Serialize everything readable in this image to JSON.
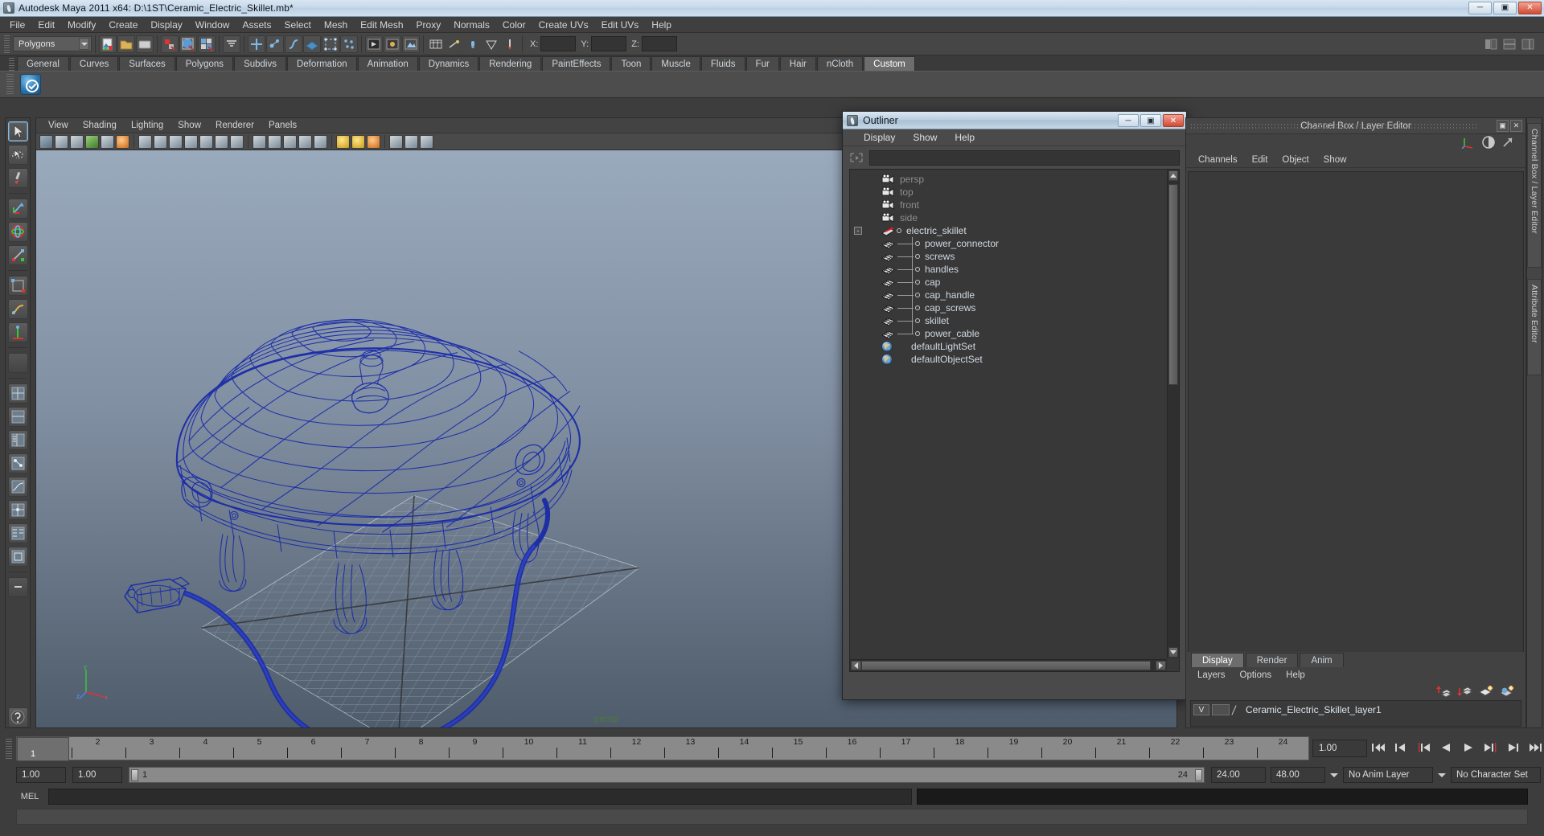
{
  "window": {
    "title": "Autodesk Maya 2011 x64: D:\\1ST\\Ceramic_Electric_Skillet.mb*",
    "minimize": "─",
    "maximize": "▣",
    "close": "✕"
  },
  "menubar": {
    "items": [
      "File",
      "Edit",
      "Modify",
      "Create",
      "Display",
      "Window",
      "Assets",
      "Select",
      "Mesh",
      "Edit Mesh",
      "Proxy",
      "Normals",
      "Color",
      "Create UVs",
      "Edit UVs",
      "Help"
    ]
  },
  "statusline": {
    "mode_selector": "Polygons",
    "axis_labels": [
      "X:",
      "Y:",
      "Z:"
    ],
    "axis_values": [
      "",
      "",
      ""
    ]
  },
  "shelf": {
    "tabs": [
      "General",
      "Curves",
      "Surfaces",
      "Polygons",
      "Subdivs",
      "Deformation",
      "Animation",
      "Dynamics",
      "Rendering",
      "PaintEffects",
      "Toon",
      "Muscle",
      "Fluids",
      "Fur",
      "Hair",
      "nCloth",
      "Custom"
    ],
    "active_tab": "Custom"
  },
  "viewport_panel": {
    "menus": [
      "View",
      "Shading",
      "Lighting",
      "Show",
      "Renderer",
      "Panels"
    ],
    "camera_label": "persp",
    "axis_letters": {
      "y": "y",
      "z": "z",
      "x": "x"
    }
  },
  "outliner": {
    "title": "Outliner",
    "menus": [
      "Display",
      "Show",
      "Help"
    ],
    "search_value": "",
    "minimize": "─",
    "maximize": "▣",
    "close": "✕",
    "items": [
      {
        "label": "persp",
        "icon": "camera-icon",
        "kind": "camera",
        "dim": true,
        "indent": 0
      },
      {
        "label": "top",
        "icon": "camera-icon",
        "kind": "camera",
        "dim": true,
        "indent": 0
      },
      {
        "label": "front",
        "icon": "camera-icon",
        "kind": "camera",
        "dim": true,
        "indent": 0
      },
      {
        "label": "side",
        "icon": "camera-icon",
        "kind": "camera",
        "dim": true,
        "indent": 0
      },
      {
        "label": "electric_skillet",
        "icon": "transform-icon",
        "kind": "group",
        "dim": false,
        "indent": 0,
        "expander": "-"
      },
      {
        "label": "power_connector",
        "icon": "mesh-icon",
        "kind": "mesh",
        "dim": false,
        "indent": 1
      },
      {
        "label": "screws",
        "icon": "mesh-icon",
        "kind": "mesh",
        "dim": false,
        "indent": 1
      },
      {
        "label": "handles",
        "icon": "mesh-icon",
        "kind": "mesh",
        "dim": false,
        "indent": 1
      },
      {
        "label": "cap",
        "icon": "mesh-icon",
        "kind": "mesh",
        "dim": false,
        "indent": 1
      },
      {
        "label": "cap_handle",
        "icon": "mesh-icon",
        "kind": "mesh",
        "dim": false,
        "indent": 1
      },
      {
        "label": "cap_screws",
        "icon": "mesh-icon",
        "kind": "mesh",
        "dim": false,
        "indent": 1
      },
      {
        "label": "skillet",
        "icon": "mesh-icon",
        "kind": "mesh",
        "dim": false,
        "indent": 1
      },
      {
        "label": "power_cable",
        "icon": "mesh-icon",
        "kind": "mesh",
        "dim": false,
        "indent": 1
      },
      {
        "label": "defaultLightSet",
        "icon": "set-icon",
        "kind": "set",
        "dim": false,
        "indent": 0
      },
      {
        "label": "defaultObjectSet",
        "icon": "set-icon",
        "kind": "set",
        "dim": false,
        "indent": 0
      }
    ]
  },
  "right_panel": {
    "title": "Channel Box / Layer Editor",
    "restore": "▣",
    "close": "✕",
    "channel_menus": [
      "Channels",
      "Edit",
      "Object",
      "Show"
    ],
    "layer_tabs": [
      "Display",
      "Render",
      "Anim"
    ],
    "layer_active_tab": "Display",
    "layer_menus": [
      "Layers",
      "Options",
      "Help"
    ],
    "layers": [
      {
        "visibility": "V",
        "type": "",
        "name": "Ceramic_Electric_Skillet_layer1"
      }
    ],
    "dock_tabs": [
      "Channel Box / Layer Editor",
      "Attribute Editor"
    ]
  },
  "timeline": {
    "ticks": [
      "1",
      "2",
      "3",
      "4",
      "5",
      "6",
      "7",
      "8",
      "9",
      "10",
      "11",
      "12",
      "13",
      "14",
      "15",
      "16",
      "17",
      "18",
      "19",
      "20",
      "21",
      "22",
      "23",
      "24"
    ],
    "current_frame_marker": "1",
    "current_frame_field": "1.00",
    "range_start": "1.00",
    "range_end": "1.00",
    "range_track_start": "1",
    "range_track_end": "24",
    "anim_start": "24.00",
    "anim_end": "48.00",
    "anim_layer": "No Anim Layer",
    "character_set": "No Character Set"
  },
  "command_line": {
    "label": "MEL",
    "value": "",
    "result": ""
  },
  "colors": {
    "wireframe": "#1a2ba8",
    "titlebar": "#c7d9ea",
    "panel_bg": "#424242",
    "viewport_top": "#93a4b8",
    "viewport_bottom": "#52606f",
    "camera_label": "#4d7a3a"
  }
}
